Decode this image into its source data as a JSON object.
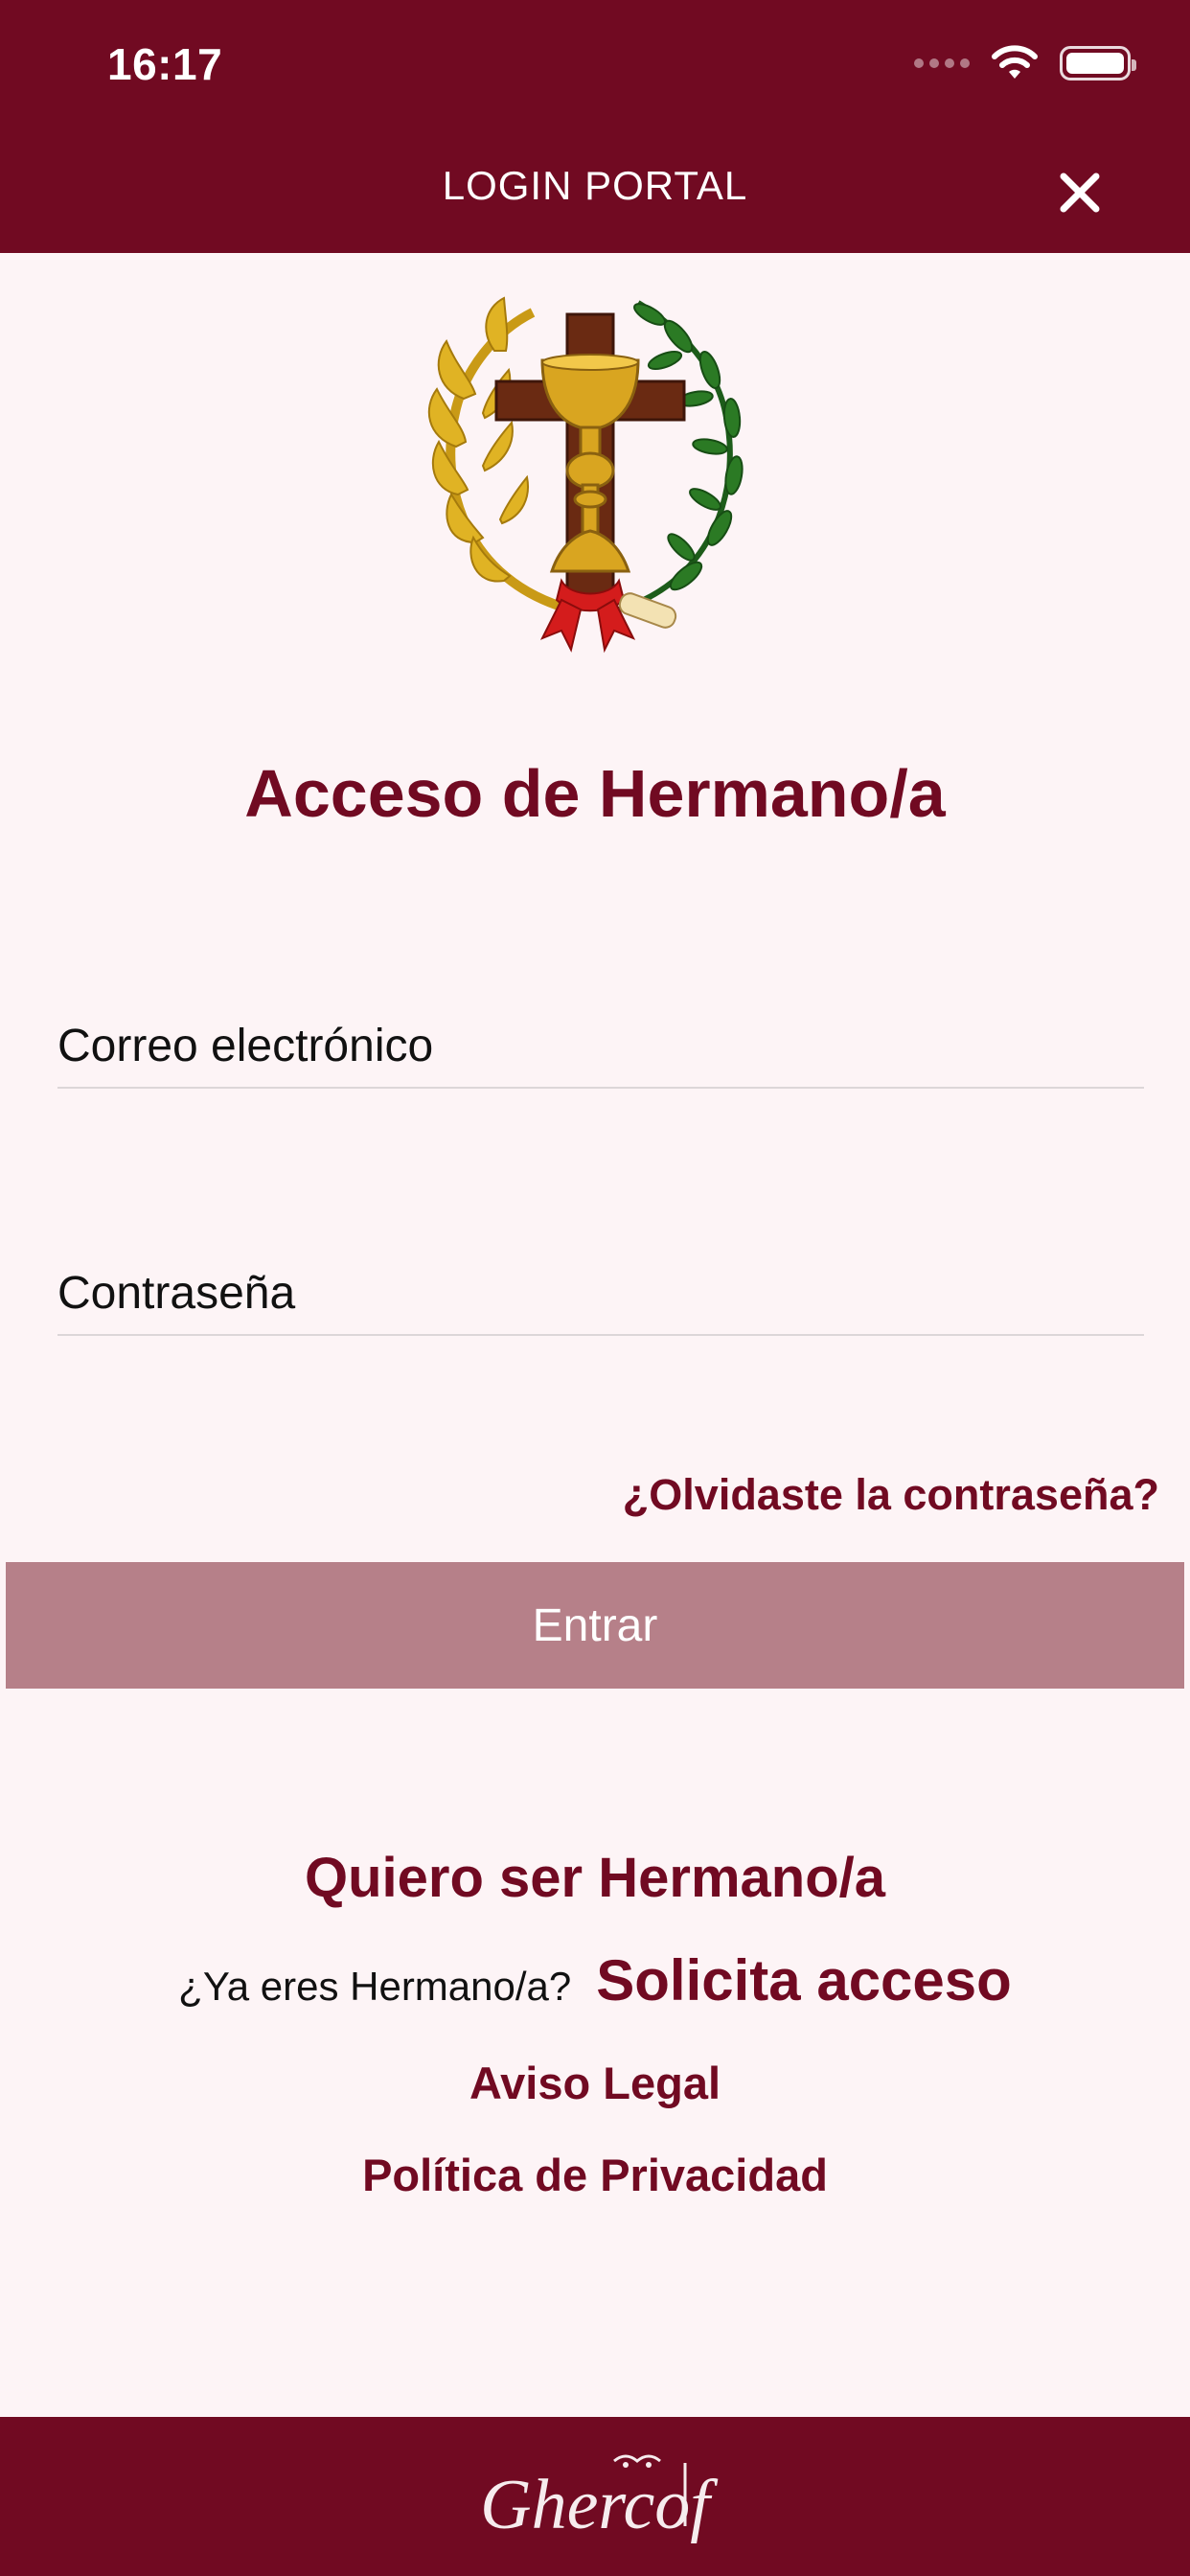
{
  "status_bar": {
    "time": "16:17",
    "icons": [
      "signal-dots-icon",
      "wifi-icon",
      "battery-icon"
    ]
  },
  "header": {
    "title": "LOGIN PORTAL",
    "close_icon": "close-icon"
  },
  "crest": {
    "icon": "brotherhood-crest-icon"
  },
  "main": {
    "heading": "Acceso de Hermano/a",
    "email_placeholder": "Correo electrónico",
    "password_placeholder": "Contraseña",
    "forgot_password": "¿Olvidaste la contraseña?",
    "enter_button": "Entrar"
  },
  "links": {
    "join": "Quiero ser Hermano/a",
    "already_member_question": "¿Ya eres Hermano/a?",
    "request_access": "Solicita acceso",
    "legal_notice": "Aviso Legal",
    "privacy_policy": "Política de Privacidad"
  },
  "footer": {
    "logo_text": "Ghercof"
  },
  "colors": {
    "brand": "#710a22",
    "background": "#fdf4f6",
    "button_disabled": "#b68089"
  }
}
